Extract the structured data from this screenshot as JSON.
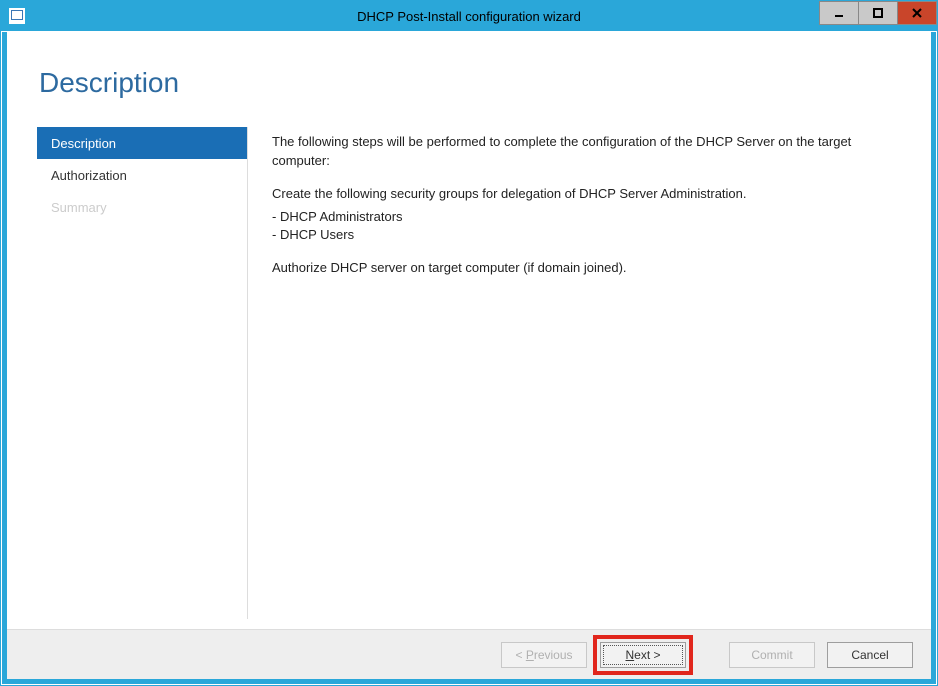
{
  "window": {
    "title": "DHCP Post-Install configuration wizard"
  },
  "heading": "Description",
  "sidebar": {
    "items": [
      {
        "label": "Description",
        "state": "selected"
      },
      {
        "label": "Authorization",
        "state": "normal"
      },
      {
        "label": "Summary",
        "state": "disabled"
      }
    ]
  },
  "content": {
    "intro": "The following steps will be performed to complete the configuration of the DHCP Server on the target computer:",
    "groups_lead": "Create the following security groups for delegation of DHCP Server Administration.",
    "groups": [
      "DHCP Administrators",
      "DHCP Users"
    ],
    "authorize": "Authorize DHCP server on target computer (if domain joined)."
  },
  "buttons": {
    "previous": "< Previous",
    "next": "Next >",
    "commit": "Commit",
    "cancel": "Cancel"
  }
}
